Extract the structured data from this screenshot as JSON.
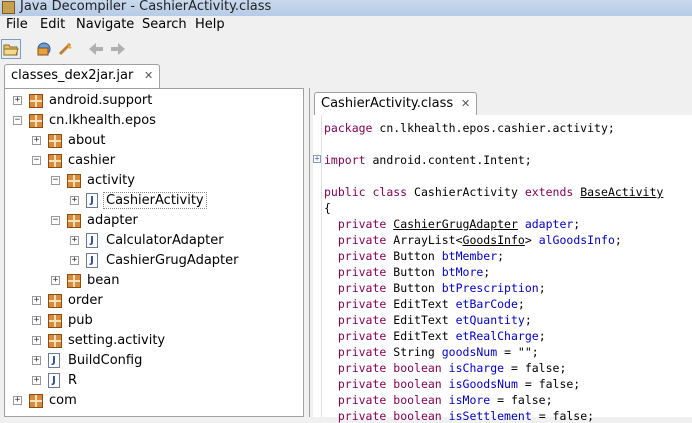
{
  "window": {
    "title": "Java Decompiler - CashierActivity.class"
  },
  "menu": [
    "File",
    "Edit",
    "Navigate",
    "Search",
    "Help"
  ],
  "toolbar": {
    "icons": [
      "open-file-icon",
      "open-jar-icon",
      "clear-icon",
      "back-arrow-icon",
      "forward-arrow-icon"
    ]
  },
  "left_tab": {
    "label": "classes_dex2jar.jar",
    "close": "✕"
  },
  "right_tab": {
    "label": "CashierActivity.class",
    "close": "✕"
  },
  "tree": [
    {
      "label": "android.support",
      "type": "package",
      "level": 0,
      "toggle": "+"
    },
    {
      "label": "cn.lkhealth.epos",
      "type": "package",
      "level": 0,
      "toggle": "−"
    },
    {
      "label": "about",
      "type": "package",
      "level": 1,
      "toggle": "+"
    },
    {
      "label": "cashier",
      "type": "package",
      "level": 1,
      "toggle": "−"
    },
    {
      "label": "activity",
      "type": "package",
      "level": 2,
      "toggle": "−"
    },
    {
      "label": "CashierActivity",
      "type": "class",
      "level": 3,
      "toggle": "+",
      "selected": true
    },
    {
      "label": "adapter",
      "type": "package",
      "level": 2,
      "toggle": "−"
    },
    {
      "label": "CalculatorAdapter",
      "type": "class",
      "level": 3,
      "toggle": "+"
    },
    {
      "label": "CashierGrugAdapter",
      "type": "class",
      "level": 3,
      "toggle": "+"
    },
    {
      "label": "bean",
      "type": "package",
      "level": 2,
      "toggle": "+"
    },
    {
      "label": "order",
      "type": "package",
      "level": 1,
      "toggle": "+"
    },
    {
      "label": "pub",
      "type": "package",
      "level": 1,
      "toggle": "+"
    },
    {
      "label": "setting.activity",
      "type": "package",
      "level": 1,
      "toggle": "+"
    },
    {
      "label": "BuildConfig",
      "type": "class",
      "level": 1,
      "toggle": "+"
    },
    {
      "label": "R",
      "type": "class",
      "level": 1,
      "toggle": "+"
    },
    {
      "label": "com",
      "type": "package",
      "level": 0,
      "toggle": "+"
    }
  ],
  "code": {
    "package_kw": "package",
    "package_name": " cn.lkhealth.epos.cashier.activity;",
    "import_kw": "import",
    "import_name": " android.content.Intent;",
    "class_decl": {
      "kw1": "public",
      "kw2": "class",
      "name": "CashierActivity",
      "kw3": "extends",
      "parent": "BaseActivity"
    },
    "open_brace": "{",
    "fields": [
      {
        "mod": "private",
        "type": "CashierGrugAdapter",
        "type_ul": true,
        "name": "adapter",
        "suffix": ";"
      },
      {
        "mod": "private",
        "type": "ArrayList<",
        "type_ul": false,
        "generic": "GoodsInfo",
        "type_end": ">",
        "name": "alGoodsInfo",
        "suffix": ";"
      },
      {
        "mod": "private",
        "type": "Button",
        "type_ul": false,
        "name": "btMember",
        "suffix": ";"
      },
      {
        "mod": "private",
        "type": "Button",
        "type_ul": false,
        "name": "btMore",
        "suffix": ";"
      },
      {
        "mod": "private",
        "type": "Button",
        "type_ul": false,
        "name": "btPrescription",
        "suffix": ";"
      },
      {
        "mod": "private",
        "type": "EditText",
        "type_ul": false,
        "name": "etBarCode",
        "suffix": ";"
      },
      {
        "mod": "private",
        "type": "EditText",
        "type_ul": false,
        "name": "etQuantity",
        "suffix": ";"
      },
      {
        "mod": "private",
        "type": "EditText",
        "type_ul": false,
        "name": "etRealCharge",
        "suffix": ";"
      },
      {
        "mod": "private",
        "type": "String",
        "type_ul": false,
        "name": "goodsNum",
        "suffix": " = \"\";"
      },
      {
        "mod": "private",
        "type": "boolean",
        "type_kw": true,
        "name": "isCharge",
        "suffix": " = false;"
      },
      {
        "mod": "private",
        "type": "boolean",
        "type_kw": true,
        "name": "isGoodsNum",
        "suffix": " = false;"
      },
      {
        "mod": "private",
        "type": "boolean",
        "type_kw": true,
        "name": "isMore",
        "suffix": " = false;"
      },
      {
        "mod": "private",
        "type": "boolean",
        "type_kw": true,
        "name": "isSettlement",
        "suffix": " = false;"
      }
    ]
  }
}
